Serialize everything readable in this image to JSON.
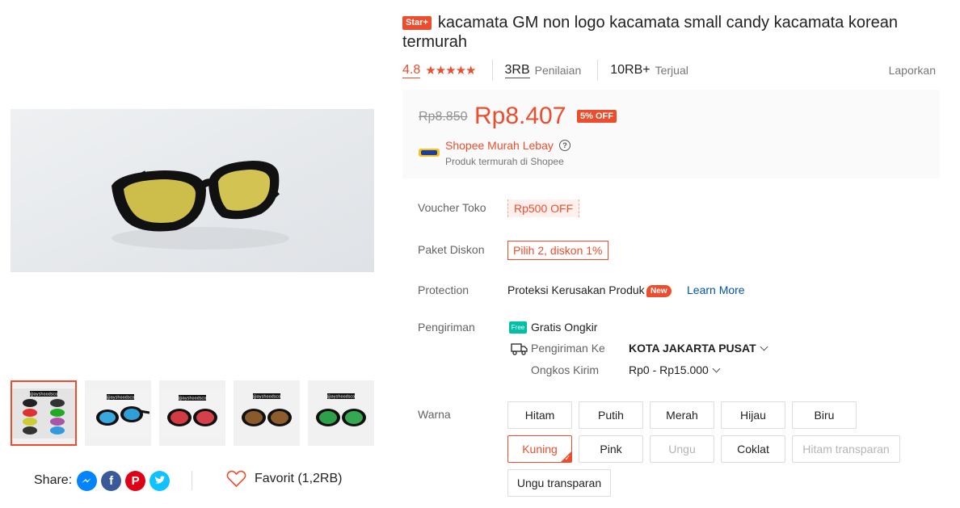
{
  "product": {
    "badge": "Star+",
    "title": "kacamata GM non logo kacamata small candy kacamata korean termurah"
  },
  "stats": {
    "rating": "4.8",
    "stars": "★★★★★",
    "reviews_count": "3RB",
    "reviews_label": "Penilaian",
    "sold_count": "10RB+",
    "sold_label": "Terjual",
    "report": "Laporkan"
  },
  "price": {
    "original": "Rp8.850",
    "current": "Rp8.407",
    "discount": "5% OFF"
  },
  "program": {
    "name": "Shopee Murah Lebay",
    "subtitle": "Produk termurah di Shopee",
    "help_icon": "?"
  },
  "voucher": {
    "label": "Voucher Toko",
    "value": "Rp500 OFF"
  },
  "bundle": {
    "label": "Paket Diskon",
    "value": "Pilih 2, diskon 1%"
  },
  "protection": {
    "label": "Protection",
    "text": "Proteksi Kerusakan Produk",
    "badge": "New",
    "link": "Learn More"
  },
  "shipping": {
    "label": "Pengiriman",
    "free_icon": "Free",
    "free_text": "Gratis Ongkir",
    "to_label": "Pengiriman Ke",
    "to_value": "KOTA JAKARTA PUSAT",
    "cost_label": "Ongkos Kirim",
    "cost_value": "Rp0 - Rp15.000"
  },
  "variations": {
    "label": "Warna",
    "options": [
      {
        "name": "Hitam",
        "state": "normal"
      },
      {
        "name": "Putih",
        "state": "normal"
      },
      {
        "name": "Merah",
        "state": "normal"
      },
      {
        "name": "Hijau",
        "state": "normal"
      },
      {
        "name": "Biru",
        "state": "normal"
      },
      {
        "name": "Kuning",
        "state": "selected"
      },
      {
        "name": "Pink",
        "state": "normal"
      },
      {
        "name": "Ungu",
        "state": "disabled"
      },
      {
        "name": "Coklat",
        "state": "normal"
      },
      {
        "name": "Hitam transparan",
        "state": "disabled"
      },
      {
        "name": "Ungu transparan",
        "state": "normal"
      }
    ]
  },
  "share": {
    "label": "Share:",
    "icons": [
      "messenger-icon",
      "facebook-icon",
      "pinterest-icon",
      "twitter-icon"
    ]
  },
  "favorite": {
    "text": "Favorit (1,2RB)"
  },
  "thumbnails": {
    "watermark": "@ayshoodsco",
    "items": [
      "multi",
      "blue",
      "red",
      "brown",
      "green"
    ]
  },
  "colors": {
    "accent": "#ee4d2d",
    "link": "#0055aa",
    "free": "#00bfa5"
  }
}
